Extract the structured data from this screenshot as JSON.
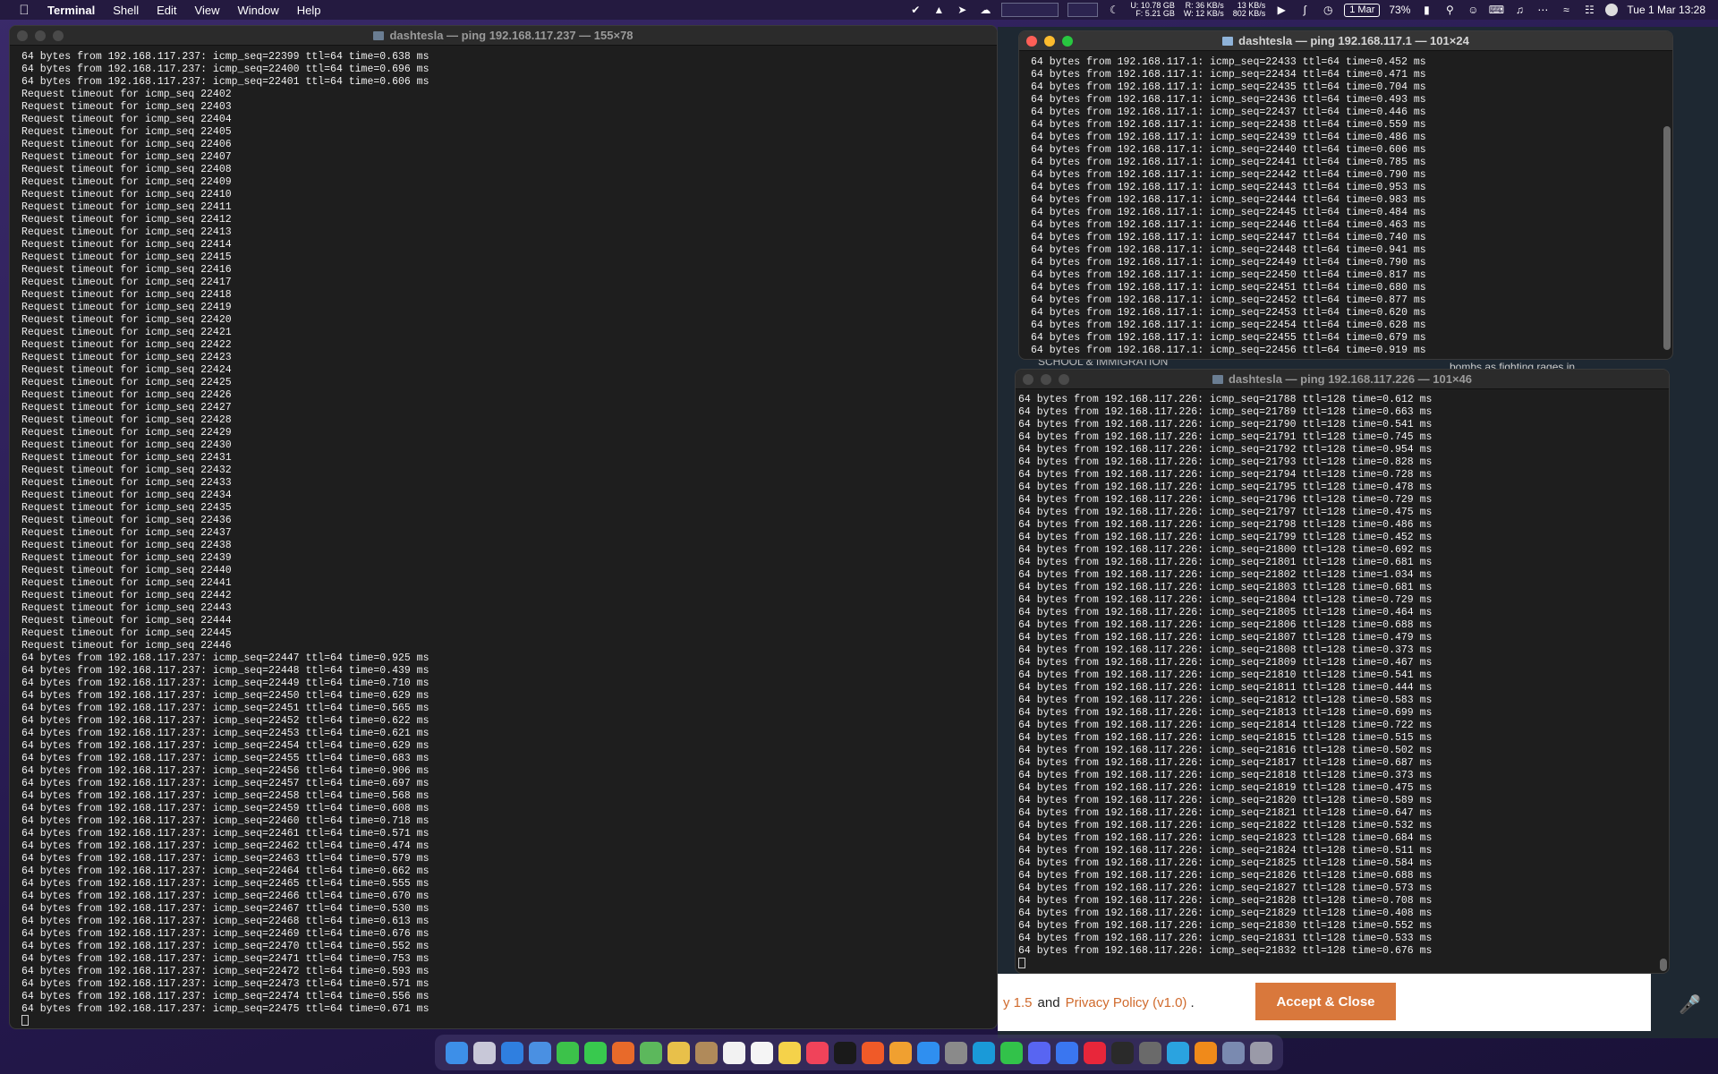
{
  "menubar": {
    "app": "Terminal",
    "items": [
      "Shell",
      "Edit",
      "View",
      "Window",
      "Help"
    ],
    "disk_u": "U: 10.78 GB",
    "disk_f": "F: 5.21 GB",
    "net_r": "R: 36 KB/s",
    "net_w": "W: 12 KB/s",
    "up": "13 KB/s",
    "down": "802 KB/s",
    "date_badge": "1 Mar",
    "battery": "73%",
    "clock": "Tue 1 Mar  13:28"
  },
  "window_left": {
    "title": "dashtesla — ping 192.168.117.237 — 155×78",
    "lines": [
      "64 bytes from 192.168.117.237: icmp_seq=22399 ttl=64 time=0.638 ms",
      "64 bytes from 192.168.117.237: icmp_seq=22400 ttl=64 time=0.696 ms",
      "64 bytes from 192.168.117.237: icmp_seq=22401 ttl=64 time=0.606 ms",
      "Request timeout for icmp_seq 22402",
      "Request timeout for icmp_seq 22403",
      "Request timeout for icmp_seq 22404",
      "Request timeout for icmp_seq 22405",
      "Request timeout for icmp_seq 22406",
      "Request timeout for icmp_seq 22407",
      "Request timeout for icmp_seq 22408",
      "Request timeout for icmp_seq 22409",
      "Request timeout for icmp_seq 22410",
      "Request timeout for icmp_seq 22411",
      "Request timeout for icmp_seq 22412",
      "Request timeout for icmp_seq 22413",
      "Request timeout for icmp_seq 22414",
      "Request timeout for icmp_seq 22415",
      "Request timeout for icmp_seq 22416",
      "Request timeout for icmp_seq 22417",
      "Request timeout for icmp_seq 22418",
      "Request timeout for icmp_seq 22419",
      "Request timeout for icmp_seq 22420",
      "Request timeout for icmp_seq 22421",
      "Request timeout for icmp_seq 22422",
      "Request timeout for icmp_seq 22423",
      "Request timeout for icmp_seq 22424",
      "Request timeout for icmp_seq 22425",
      "Request timeout for icmp_seq 22426",
      "Request timeout for icmp_seq 22427",
      "Request timeout for icmp_seq 22428",
      "Request timeout for icmp_seq 22429",
      "Request timeout for icmp_seq 22430",
      "Request timeout for icmp_seq 22431",
      "Request timeout for icmp_seq 22432",
      "Request timeout for icmp_seq 22433",
      "Request timeout for icmp_seq 22434",
      "Request timeout for icmp_seq 22435",
      "Request timeout for icmp_seq 22436",
      "Request timeout for icmp_seq 22437",
      "Request timeout for icmp_seq 22438",
      "Request timeout for icmp_seq 22439",
      "Request timeout for icmp_seq 22440",
      "Request timeout for icmp_seq 22441",
      "Request timeout for icmp_seq 22442",
      "Request timeout for icmp_seq 22443",
      "Request timeout for icmp_seq 22444",
      "Request timeout for icmp_seq 22445",
      "Request timeout for icmp_seq 22446",
      "64 bytes from 192.168.117.237: icmp_seq=22447 ttl=64 time=0.925 ms",
      "64 bytes from 192.168.117.237: icmp_seq=22448 ttl=64 time=0.439 ms",
      "64 bytes from 192.168.117.237: icmp_seq=22449 ttl=64 time=0.710 ms",
      "64 bytes from 192.168.117.237: icmp_seq=22450 ttl=64 time=0.629 ms",
      "64 bytes from 192.168.117.237: icmp_seq=22451 ttl=64 time=0.565 ms",
      "64 bytes from 192.168.117.237: icmp_seq=22452 ttl=64 time=0.622 ms",
      "64 bytes from 192.168.117.237: icmp_seq=22453 ttl=64 time=0.621 ms",
      "64 bytes from 192.168.117.237: icmp_seq=22454 ttl=64 time=0.629 ms",
      "64 bytes from 192.168.117.237: icmp_seq=22455 ttl=64 time=0.683 ms",
      "64 bytes from 192.168.117.237: icmp_seq=22456 ttl=64 time=0.906 ms",
      "64 bytes from 192.168.117.237: icmp_seq=22457 ttl=64 time=0.697 ms",
      "64 bytes from 192.168.117.237: icmp_seq=22458 ttl=64 time=0.568 ms",
      "64 bytes from 192.168.117.237: icmp_seq=22459 ttl=64 time=0.608 ms",
      "64 bytes from 192.168.117.237: icmp_seq=22460 ttl=64 time=0.718 ms",
      "64 bytes from 192.168.117.237: icmp_seq=22461 ttl=64 time=0.571 ms",
      "64 bytes from 192.168.117.237: icmp_seq=22462 ttl=64 time=0.474 ms",
      "64 bytes from 192.168.117.237: icmp_seq=22463 ttl=64 time=0.579 ms",
      "64 bytes from 192.168.117.237: icmp_seq=22464 ttl=64 time=0.662 ms",
      "64 bytes from 192.168.117.237: icmp_seq=22465 ttl=64 time=0.555 ms",
      "64 bytes from 192.168.117.237: icmp_seq=22466 ttl=64 time=0.670 ms",
      "64 bytes from 192.168.117.237: icmp_seq=22467 ttl=64 time=0.530 ms",
      "64 bytes from 192.168.117.237: icmp_seq=22468 ttl=64 time=0.613 ms",
      "64 bytes from 192.168.117.237: icmp_seq=22469 ttl=64 time=0.676 ms",
      "64 bytes from 192.168.117.237: icmp_seq=22470 ttl=64 time=0.552 ms",
      "64 bytes from 192.168.117.237: icmp_seq=22471 ttl=64 time=0.753 ms",
      "64 bytes from 192.168.117.237: icmp_seq=22472 ttl=64 time=0.593 ms",
      "64 bytes from 192.168.117.237: icmp_seq=22473 ttl=64 time=0.571 ms",
      "64 bytes from 192.168.117.237: icmp_seq=22474 ttl=64 time=0.556 ms",
      "64 bytes from 192.168.117.237: icmp_seq=22475 ttl=64 time=0.671 ms"
    ]
  },
  "window_top_right": {
    "title": "dashtesla — ping 192.168.117.1 — 101×24",
    "lines": [
      "64 bytes from 192.168.117.1: icmp_seq=22433 ttl=64 time=0.452 ms",
      "64 bytes from 192.168.117.1: icmp_seq=22434 ttl=64 time=0.471 ms",
      "64 bytes from 192.168.117.1: icmp_seq=22435 ttl=64 time=0.704 ms",
      "64 bytes from 192.168.117.1: icmp_seq=22436 ttl=64 time=0.493 ms",
      "64 bytes from 192.168.117.1: icmp_seq=22437 ttl=64 time=0.446 ms",
      "64 bytes from 192.168.117.1: icmp_seq=22438 ttl=64 time=0.559 ms",
      "64 bytes from 192.168.117.1: icmp_seq=22439 ttl=64 time=0.486 ms",
      "64 bytes from 192.168.117.1: icmp_seq=22440 ttl=64 time=0.606 ms",
      "64 bytes from 192.168.117.1: icmp_seq=22441 ttl=64 time=0.785 ms",
      "64 bytes from 192.168.117.1: icmp_seq=22442 ttl=64 time=0.790 ms",
      "64 bytes from 192.168.117.1: icmp_seq=22443 ttl=64 time=0.953 ms",
      "64 bytes from 192.168.117.1: icmp_seq=22444 ttl=64 time=0.983 ms",
      "64 bytes from 192.168.117.1: icmp_seq=22445 ttl=64 time=0.484 ms",
      "64 bytes from 192.168.117.1: icmp_seq=22446 ttl=64 time=0.463 ms",
      "64 bytes from 192.168.117.1: icmp_seq=22447 ttl=64 time=0.740 ms",
      "64 bytes from 192.168.117.1: icmp_seq=22448 ttl=64 time=0.941 ms",
      "64 bytes from 192.168.117.1: icmp_seq=22449 ttl=64 time=0.790 ms",
      "64 bytes from 192.168.117.1: icmp_seq=22450 ttl=64 time=0.817 ms",
      "64 bytes from 192.168.117.1: icmp_seq=22451 ttl=64 time=0.680 ms",
      "64 bytes from 192.168.117.1: icmp_seq=22452 ttl=64 time=0.877 ms",
      "64 bytes from 192.168.117.1: icmp_seq=22453 ttl=64 time=0.620 ms",
      "64 bytes from 192.168.117.1: icmp_seq=22454 ttl=64 time=0.628 ms",
      "64 bytes from 192.168.117.1: icmp_seq=22455 ttl=64 time=0.679 ms",
      "64 bytes from 192.168.117.1: icmp_seq=22456 ttl=64 time=0.919 ms"
    ]
  },
  "window_bottom_right": {
    "title": "dashtesla — ping 192.168.117.226 — 101×46",
    "lines": [
      "64 bytes from 192.168.117.226: icmp_seq=21788 ttl=128 time=0.612 ms",
      "64 bytes from 192.168.117.226: icmp_seq=21789 ttl=128 time=0.663 ms",
      "64 bytes from 192.168.117.226: icmp_seq=21790 ttl=128 time=0.541 ms",
      "64 bytes from 192.168.117.226: icmp_seq=21791 ttl=128 time=0.745 ms",
      "64 bytes from 192.168.117.226: icmp_seq=21792 ttl=128 time=0.954 ms",
      "64 bytes from 192.168.117.226: icmp_seq=21793 ttl=128 time=0.828 ms",
      "64 bytes from 192.168.117.226: icmp_seq=21794 ttl=128 time=0.728 ms",
      "64 bytes from 192.168.117.226: icmp_seq=21795 ttl=128 time=0.478 ms",
      "64 bytes from 192.168.117.226: icmp_seq=21796 ttl=128 time=0.729 ms",
      "64 bytes from 192.168.117.226: icmp_seq=21797 ttl=128 time=0.475 ms",
      "64 bytes from 192.168.117.226: icmp_seq=21798 ttl=128 time=0.486 ms",
      "64 bytes from 192.168.117.226: icmp_seq=21799 ttl=128 time=0.452 ms",
      "64 bytes from 192.168.117.226: icmp_seq=21800 ttl=128 time=0.692 ms",
      "64 bytes from 192.168.117.226: icmp_seq=21801 ttl=128 time=0.681 ms",
      "64 bytes from 192.168.117.226: icmp_seq=21802 ttl=128 time=1.034 ms",
      "64 bytes from 192.168.117.226: icmp_seq=21803 ttl=128 time=0.681 ms",
      "64 bytes from 192.168.117.226: icmp_seq=21804 ttl=128 time=0.729 ms",
      "64 bytes from 192.168.117.226: icmp_seq=21805 ttl=128 time=0.464 ms",
      "64 bytes from 192.168.117.226: icmp_seq=21806 ttl=128 time=0.688 ms",
      "64 bytes from 192.168.117.226: icmp_seq=21807 ttl=128 time=0.479 ms",
      "64 bytes from 192.168.117.226: icmp_seq=21808 ttl=128 time=0.373 ms",
      "64 bytes from 192.168.117.226: icmp_seq=21809 ttl=128 time=0.467 ms",
      "64 bytes from 192.168.117.226: icmp_seq=21810 ttl=128 time=0.541 ms",
      "64 bytes from 192.168.117.226: icmp_seq=21811 ttl=128 time=0.444 ms",
      "64 bytes from 192.168.117.226: icmp_seq=21812 ttl=128 time=0.583 ms",
      "64 bytes from 192.168.117.226: icmp_seq=21813 ttl=128 time=0.699 ms",
      "64 bytes from 192.168.117.226: icmp_seq=21814 ttl=128 time=0.722 ms",
      "64 bytes from 192.168.117.226: icmp_seq=21815 ttl=128 time=0.515 ms",
      "64 bytes from 192.168.117.226: icmp_seq=21816 ttl=128 time=0.502 ms",
      "64 bytes from 192.168.117.226: icmp_seq=21817 ttl=128 time=0.687 ms",
      "64 bytes from 192.168.117.226: icmp_seq=21818 ttl=128 time=0.373 ms",
      "64 bytes from 192.168.117.226: icmp_seq=21819 ttl=128 time=0.475 ms",
      "64 bytes from 192.168.117.226: icmp_seq=21820 ttl=128 time=0.589 ms",
      "64 bytes from 192.168.117.226: icmp_seq=21821 ttl=128 time=0.647 ms",
      "64 bytes from 192.168.117.226: icmp_seq=21822 ttl=128 time=0.532 ms",
      "64 bytes from 192.168.117.226: icmp_seq=21823 ttl=128 time=0.684 ms",
      "64 bytes from 192.168.117.226: icmp_seq=21824 ttl=128 time=0.511 ms",
      "64 bytes from 192.168.117.226: icmp_seq=21825 ttl=128 time=0.584 ms",
      "64 bytes from 192.168.117.226: icmp_seq=21826 ttl=128 time=0.688 ms",
      "64 bytes from 192.168.117.226: icmp_seq=21827 ttl=128 time=0.573 ms",
      "64 bytes from 192.168.117.226: icmp_seq=21828 ttl=128 time=0.708 ms",
      "64 bytes from 192.168.117.226: icmp_seq=21829 ttl=128 time=0.408 ms",
      "64 bytes from 192.168.117.226: icmp_seq=21830 ttl=128 time=0.552 ms",
      "64 bytes from 192.168.117.226: icmp_seq=21831 ttl=128 time=0.533 ms",
      "64 bytes from 192.168.117.226: icmp_seq=21832 ttl=128 time=0.676 ms"
    ]
  },
  "background_page": {
    "terms_fragment": "y 1.5",
    "and_text": "and",
    "privacy_link": "Privacy Policy (v1.0)",
    "period": ".",
    "accept_button": "Accept & Close",
    "headline_fragment": "bombs as fighting rages in"
  },
  "colors": {
    "terminal_bg": "#1e1e1e",
    "accept_button": "#d9783c",
    "link": "#d06a2c"
  },
  "dock": {
    "icons": [
      {
        "name": "finder",
        "color": "#3d8fe8"
      },
      {
        "name": "launchpad",
        "color": "#c8c8d8"
      },
      {
        "name": "safari",
        "color": "#2f7fe0"
      },
      {
        "name": "mail",
        "color": "#4a90e2"
      },
      {
        "name": "facetime",
        "color": "#3cc24a"
      },
      {
        "name": "messages",
        "color": "#38c94e"
      },
      {
        "name": "firefox",
        "color": "#e86a2a"
      },
      {
        "name": "maps",
        "color": "#5cb85c"
      },
      {
        "name": "photos",
        "color": "#e8c04a"
      },
      {
        "name": "archive",
        "color": "#b08a5a"
      },
      {
        "name": "calendar",
        "color": "#f2f2f2"
      },
      {
        "name": "reminders",
        "color": "#f5f5f5"
      },
      {
        "name": "notes",
        "color": "#f5d24a"
      },
      {
        "name": "music",
        "color": "#f0435a"
      },
      {
        "name": "tv",
        "color": "#1a1a1a"
      },
      {
        "name": "brave",
        "color": "#f05a28"
      },
      {
        "name": "pages",
        "color": "#f0a030"
      },
      {
        "name": "app-store",
        "color": "#2f8ff0"
      },
      {
        "name": "system-preferences",
        "color": "#8a8a8a"
      },
      {
        "name": "skype",
        "color": "#1a9ad8"
      },
      {
        "name": "whatsapp",
        "color": "#32c24a"
      },
      {
        "name": "discord",
        "color": "#5865f2"
      },
      {
        "name": "signal",
        "color": "#3a76f0"
      },
      {
        "name": "opera",
        "color": "#e8263a"
      },
      {
        "name": "terminal",
        "color": "#2a2a2a"
      },
      {
        "name": "calculator",
        "color": "#6a6a6a"
      },
      {
        "name": "telegram",
        "color": "#2aa3e0"
      },
      {
        "name": "vlc",
        "color": "#f08a1a"
      },
      {
        "name": "preview",
        "color": "#7a8ab0"
      },
      {
        "name": "trash",
        "color": "#9a9aa8"
      }
    ]
  }
}
